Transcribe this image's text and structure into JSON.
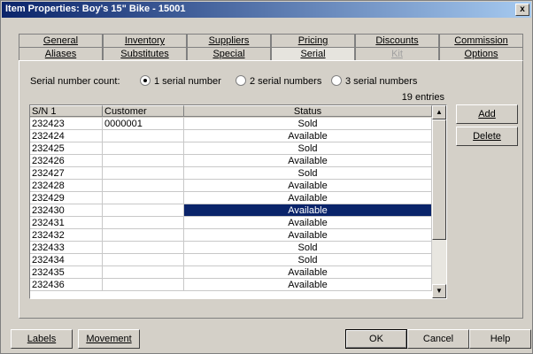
{
  "window": {
    "title": "Item Properties: Boy's 15\" Bike - 15001",
    "close_glyph": "x"
  },
  "tabs_row1": [
    "General",
    "Inventory",
    "Suppliers",
    "Pricing",
    "Discounts",
    "Commission"
  ],
  "tabs_row2": [
    "Aliases",
    "Substitutes",
    "Special",
    "Serial",
    "Kit",
    "Options"
  ],
  "active_tab": "Serial",
  "disabled_tabs": [
    "Kit"
  ],
  "serial": {
    "count_label": "Serial number count:",
    "options": [
      "1 serial number",
      "2 serial numbers",
      "3 serial numbers"
    ],
    "selected_option": "1 serial number",
    "entries": "19 entries"
  },
  "grid": {
    "columns": [
      "S/N 1",
      "Customer",
      "Status"
    ],
    "rows": [
      {
        "sn": "232423",
        "customer": "0000001",
        "status": "Sold"
      },
      {
        "sn": "232424",
        "customer": "",
        "status": "Available"
      },
      {
        "sn": "232425",
        "customer": "",
        "status": "Sold"
      },
      {
        "sn": "232426",
        "customer": "",
        "status": "Available"
      },
      {
        "sn": "232427",
        "customer": "",
        "status": "Sold"
      },
      {
        "sn": "232428",
        "customer": "",
        "status": "Available"
      },
      {
        "sn": "232429",
        "customer": "",
        "status": "Available"
      },
      {
        "sn": "232430",
        "customer": "",
        "status": "Available",
        "selected": true
      },
      {
        "sn": "232431",
        "customer": "",
        "status": "Available"
      },
      {
        "sn": "232432",
        "customer": "",
        "status": "Available"
      },
      {
        "sn": "232433",
        "customer": "",
        "status": "Sold"
      },
      {
        "sn": "232434",
        "customer": "",
        "status": "Sold"
      },
      {
        "sn": "232435",
        "customer": "",
        "status": "Available"
      },
      {
        "sn": "232436",
        "customer": "",
        "status": "Available"
      }
    ]
  },
  "side_buttons": {
    "add": "Add",
    "delete": "Delete"
  },
  "bottom_buttons": {
    "labels": "Labels",
    "movement": "Movement",
    "ok": "OK",
    "cancel": "Cancel",
    "help": "Help"
  },
  "colors": {
    "selection": "#0a246a",
    "titlebar_start": "#0a246a",
    "titlebar_end": "#a6caf0",
    "face": "#d4d0c8"
  }
}
